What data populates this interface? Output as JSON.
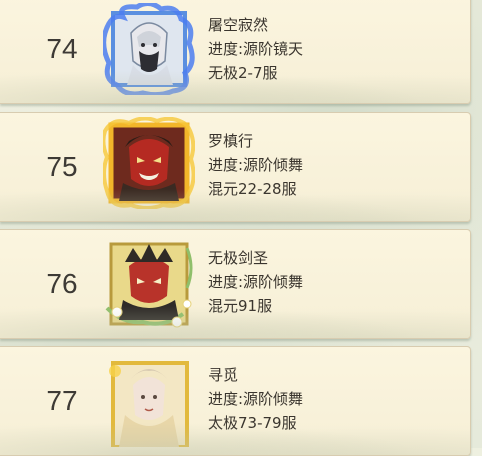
{
  "entries": [
    {
      "rank": "74",
      "name": "屠空寂然",
      "progress": "进度:源阶镜天",
      "server": "无极2-7服",
      "frame": "blue-flame-frame"
    },
    {
      "rank": "75",
      "name": "罗槙行",
      "progress": "进度:源阶倾舞",
      "server": "混元22-28服",
      "frame": "gold-flame-frame"
    },
    {
      "rank": "76",
      "name": "无极剑圣",
      "progress": "进度:源阶倾舞",
      "server": "混元91服",
      "frame": "flower-vine-frame"
    },
    {
      "rank": "77",
      "name": "寻觅",
      "progress": "进度:源阶倾舞",
      "server": "太极73-79服",
      "frame": "gold-frame"
    }
  ]
}
